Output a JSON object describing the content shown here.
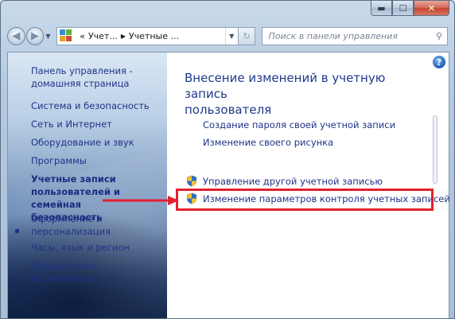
{
  "window": {
    "caption": {
      "minimize": "▬",
      "maximize": "☐",
      "close": "✕"
    }
  },
  "nav": {
    "back_glyph": "◀",
    "forward_glyph": "▶",
    "address": {
      "prefix": "«",
      "segments": [
        "Учет...",
        "Учетные ..."
      ],
      "separator": "▶",
      "dropdown": "▼",
      "go_glyph": "↻"
    },
    "search": {
      "placeholder": "Поиск в панели управления",
      "icon": "⚲"
    }
  },
  "sidebar": {
    "items": [
      {
        "label": "Панель управления -",
        "label2": "домашняя страница"
      },
      {
        "label": "Система и безопасность"
      },
      {
        "label": "Сеть и Интернет"
      },
      {
        "label": "Оборудование и звук"
      },
      {
        "label": "Программы"
      },
      {
        "label": "Учетные записи",
        "label2": "пользователей и семейная",
        "label3": "безопасность"
      },
      {
        "label": "Оформление и",
        "label2": "персонализация"
      },
      {
        "label": "Часы, язык и регион"
      },
      {
        "label": "Специальные возможности"
      }
    ]
  },
  "main": {
    "help": "?",
    "title_line1": "Внесение изменений в учетную запись",
    "title_line2": "пользователя",
    "tasks": [
      {
        "label": "Создание пароля своей учетной записи",
        "icon": "none"
      },
      {
        "label": "Изменение своего рисунка",
        "icon": "none"
      },
      {
        "label": "Управление другой учетной записью",
        "icon": "uac-shield-icon"
      },
      {
        "label": "Изменение параметров контроля учетных записей",
        "icon": "uac-shield-icon"
      }
    ]
  },
  "colors": {
    "link": "#1e3287",
    "highlight": "#e3212e",
    "title": "#1e3a8a"
  }
}
